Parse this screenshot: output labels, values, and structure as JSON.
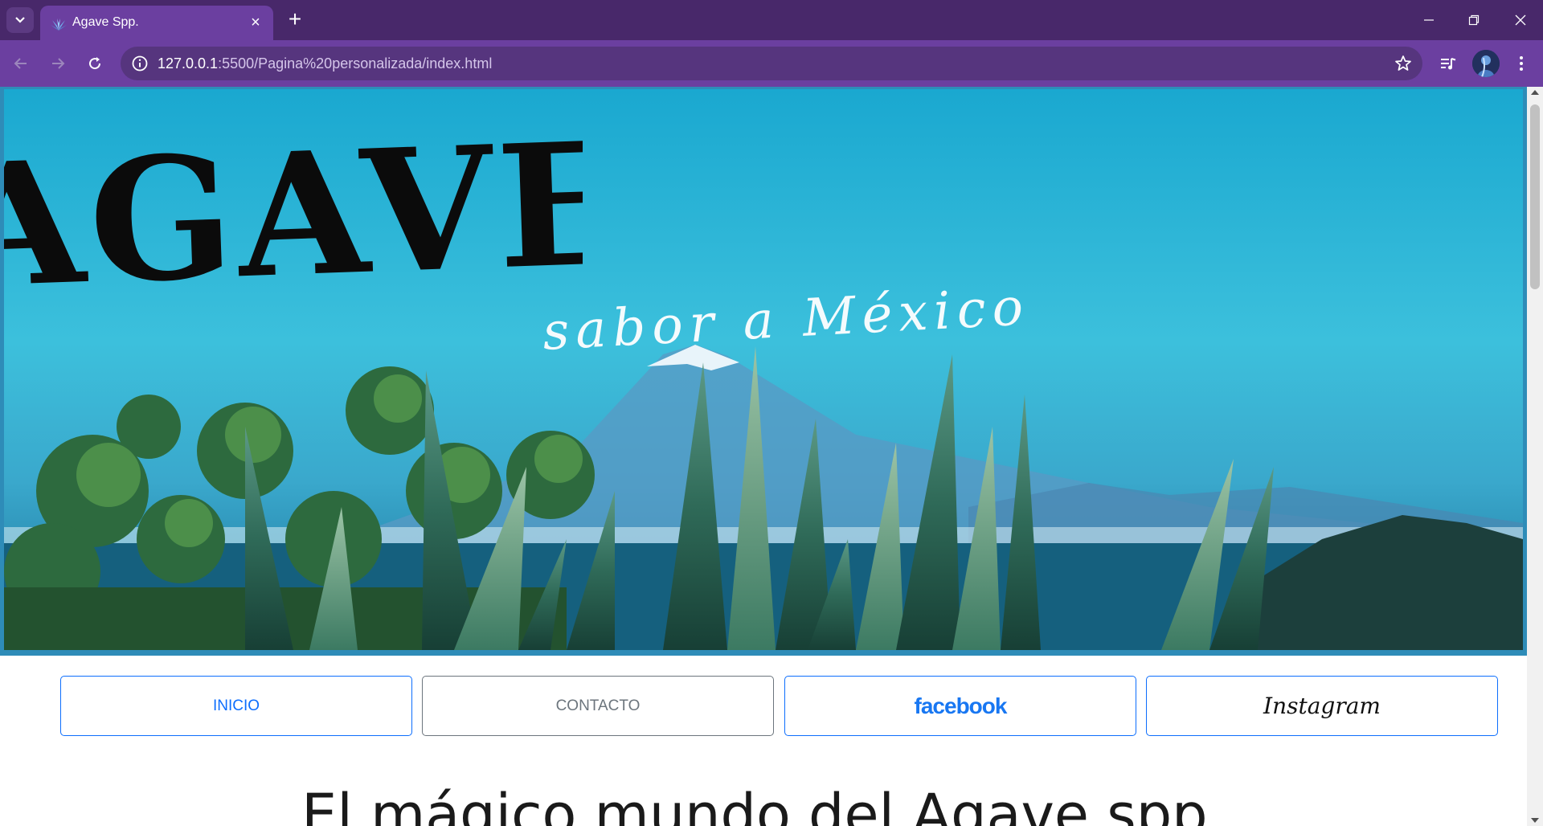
{
  "browser": {
    "tab_title": "Agave Spp.",
    "url_host": "127.0.0.1",
    "url_path": ":5500/Pagina%20personalizada/index.html",
    "icons": {
      "tab_menu": "chevron-down-icon",
      "favicon": "agave-favicon-icon",
      "close_tab": "close-icon",
      "new_tab": "plus-icon",
      "back": "arrow-left-icon",
      "forward": "arrow-right-icon",
      "reload": "reload-icon",
      "site_info": "info-icon",
      "bookmark": "star-icon",
      "media": "media-queue-icon",
      "profile": "avatar-icon",
      "menu": "kebab-menu-icon",
      "minimize": "minimize-icon",
      "restore": "restore-icon",
      "close_window": "close-icon"
    },
    "colors": {
      "frame": "#48286a",
      "toolbar": "#6b3fa0"
    }
  },
  "page": {
    "hero": {
      "brand": "AGAVE",
      "tagline": "sabor a México"
    },
    "nav": [
      {
        "label": "INICIO",
        "style": "blue"
      },
      {
        "label": "CONTACTO",
        "style": "gray"
      },
      {
        "label": "facebook",
        "style": "blue"
      },
      {
        "label": "Instagram",
        "style": "blue"
      }
    ],
    "heading": "El mágico mundo del Agave spp.",
    "colors": {
      "primary": "#0d6efd",
      "secondary": "#6c757d",
      "facebook": "#1877f2"
    }
  }
}
